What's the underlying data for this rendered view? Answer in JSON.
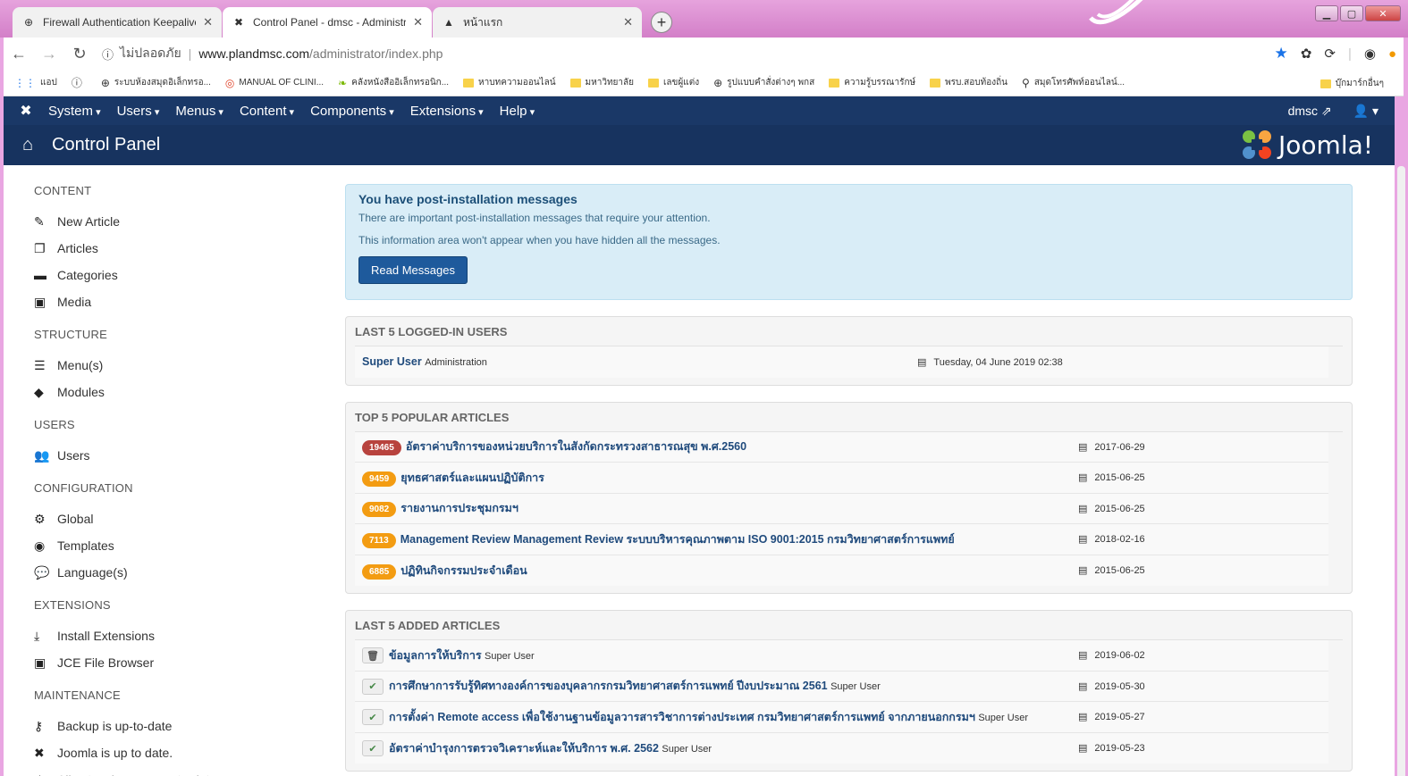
{
  "browser": {
    "tabs": [
      {
        "title": "Firewall Authentication Keepalive",
        "icon": "globe-icon"
      },
      {
        "title": "Control Panel - dmsc - Administr",
        "icon": "joomla-icon"
      },
      {
        "title": "หน้าแรก",
        "icon": "drive-icon"
      }
    ],
    "address": {
      "security": "ไม่ปลอดภัย",
      "host": "www.plandmsc.com",
      "path": "/administrator/index.php"
    },
    "bookmarks": [
      {
        "label": "แอป",
        "icon": "apps-icon"
      },
      {
        "label": "",
        "icon": "info-icon"
      },
      {
        "label": "ระบบห้องสมุดอิเล็กทรอ...",
        "icon": "globe-icon"
      },
      {
        "label": "MANUAL OF CLINI...",
        "icon": "target-icon"
      },
      {
        "label": "คลังหนังสืออิเล็กทรอนิก...",
        "icon": "leaf-icon"
      },
      {
        "label": "หาบทความออนไลน์",
        "icon": "folder-icon"
      },
      {
        "label": "มหาวิทยาลัย",
        "icon": "folder-icon"
      },
      {
        "label": "เลขผู้แต่ง",
        "icon": "folder-icon"
      },
      {
        "label": "รูปแบบคำสั่งต่างๆ พกส",
        "icon": "globe-icon"
      },
      {
        "label": "ความรู้บรรณารักษ์",
        "icon": "folder-icon"
      },
      {
        "label": "พรบ.สอบท้องถิ่น",
        "icon": "folder-icon"
      },
      {
        "label": "สมุดโทรศัพท์ออนไลน์...",
        "icon": "map-icon"
      }
    ],
    "other_bookmarks": "บุ๊กมาร์กอื่นๆ"
  },
  "joomla": {
    "menu": [
      "System",
      "Users",
      "Menus",
      "Content",
      "Components",
      "Extensions",
      "Help"
    ],
    "user": "dmsc",
    "page_title": "Control Panel",
    "logo": "Joomla!"
  },
  "sidebar": [
    {
      "heading": "CONTENT",
      "items": [
        {
          "label": "New Article",
          "icon": "pencil-icon",
          "glyph": "✎"
        },
        {
          "label": "Articles",
          "icon": "copy-icon",
          "glyph": "❐"
        },
        {
          "label": "Categories",
          "icon": "folder-open-icon",
          "glyph": "▬"
        },
        {
          "label": "Media",
          "icon": "image-icon",
          "glyph": "▣"
        }
      ]
    },
    {
      "heading": "STRUCTURE",
      "items": [
        {
          "label": "Menu(s)",
          "icon": "list-icon",
          "glyph": "☰"
        },
        {
          "label": "Modules",
          "icon": "cube-icon",
          "glyph": "◆"
        }
      ]
    },
    {
      "heading": "USERS",
      "items": [
        {
          "label": "Users",
          "icon": "users-icon",
          "glyph": "👥"
        }
      ]
    },
    {
      "heading": "CONFIGURATION",
      "items": [
        {
          "label": "Global",
          "icon": "gear-icon",
          "glyph": "⚙"
        },
        {
          "label": "Templates",
          "icon": "eye-icon",
          "glyph": "◉"
        },
        {
          "label": "Language(s)",
          "icon": "comments-icon",
          "glyph": "💬"
        }
      ]
    },
    {
      "heading": "EXTENSIONS",
      "items": [
        {
          "label": "Install Extensions",
          "icon": "download-icon",
          "glyph": "⤓"
        },
        {
          "label": "JCE File Browser",
          "icon": "image-icon",
          "glyph": "▣"
        }
      ]
    },
    {
      "heading": "MAINTENANCE",
      "items": [
        {
          "label": "Backup is up-to-date",
          "icon": "key-icon",
          "glyph": "⚷"
        },
        {
          "label": "Joomla is up to date.",
          "icon": "joomla-icon",
          "glyph": "✖"
        },
        {
          "label": "All extensions are up-to-date",
          "icon": "star-icon",
          "glyph": "☆"
        }
      ]
    }
  ],
  "alert": {
    "title": "You have post-installation messages",
    "line1": "There are important post-installation messages that require your attention.",
    "line2": "This information area won't appear when you have hidden all the messages.",
    "button": "Read Messages"
  },
  "logged_in": {
    "heading": "LAST 5 LOGGED-IN USERS",
    "rows": [
      {
        "name": "Super User",
        "sub": "Administration",
        "date": "Tuesday, 04 June 2019 02:38"
      }
    ]
  },
  "popular": {
    "heading": "TOP 5 POPULAR ARTICLES",
    "rows": [
      {
        "hits": "19465",
        "color": "#b8433e",
        "title": "อัตราค่าบริการของหน่วยบริการในสังกัดกระทรวงสาธารณสุข พ.ศ.2560",
        "date": "2017-06-29"
      },
      {
        "hits": "9459",
        "color": "#f39c12",
        "title": "ยุทธศาสตร์และแผนปฏิบัติการ",
        "date": "2015-06-25"
      },
      {
        "hits": "9082",
        "color": "#f39c12",
        "title": "รายงานการประชุมกรมฯ",
        "date": "2015-06-25"
      },
      {
        "hits": "7113",
        "color": "#f39c12",
        "title": "Management Review Management Review ระบบบริหารคุณภาพตาม ISO 9001:2015 กรมวิทยาศาสตร์การแพทย์",
        "date": "2018-02-16"
      },
      {
        "hits": "6885",
        "color": "#f39c12",
        "title": "ปฏิทินกิจกรรมประจำเดือน",
        "date": "2015-06-25"
      }
    ]
  },
  "added": {
    "heading": "LAST 5 ADDED ARTICLES",
    "rows": [
      {
        "status": "trashed",
        "title": "ข้อมูลการให้บริการ",
        "author": "Super User",
        "date": "2019-06-02"
      },
      {
        "status": "published",
        "title": "การศึกษาการรับรู้ทิศทางองค์การของบุคลากรกรมวิทยาศาสตร์การแพทย์ ปีงบประมาณ 2561",
        "author": "Super User",
        "date": "2019-05-30"
      },
      {
        "status": "published",
        "title": "การตั้งค่า Remote access เพื่อใช้งานฐานข้อมูลวารสารวิชาการต่างประเทศ กรมวิทยาศาสตร์การแพทย์ จากภายนอกกรมฯ",
        "author": "Super User",
        "date": "2019-05-27"
      },
      {
        "status": "published",
        "title": "อัตราค่าบำรุงการตรวจวิเคราะห์และให้บริการ พ.ศ. 2562",
        "author": "Super User",
        "date": "2019-05-23"
      }
    ]
  }
}
